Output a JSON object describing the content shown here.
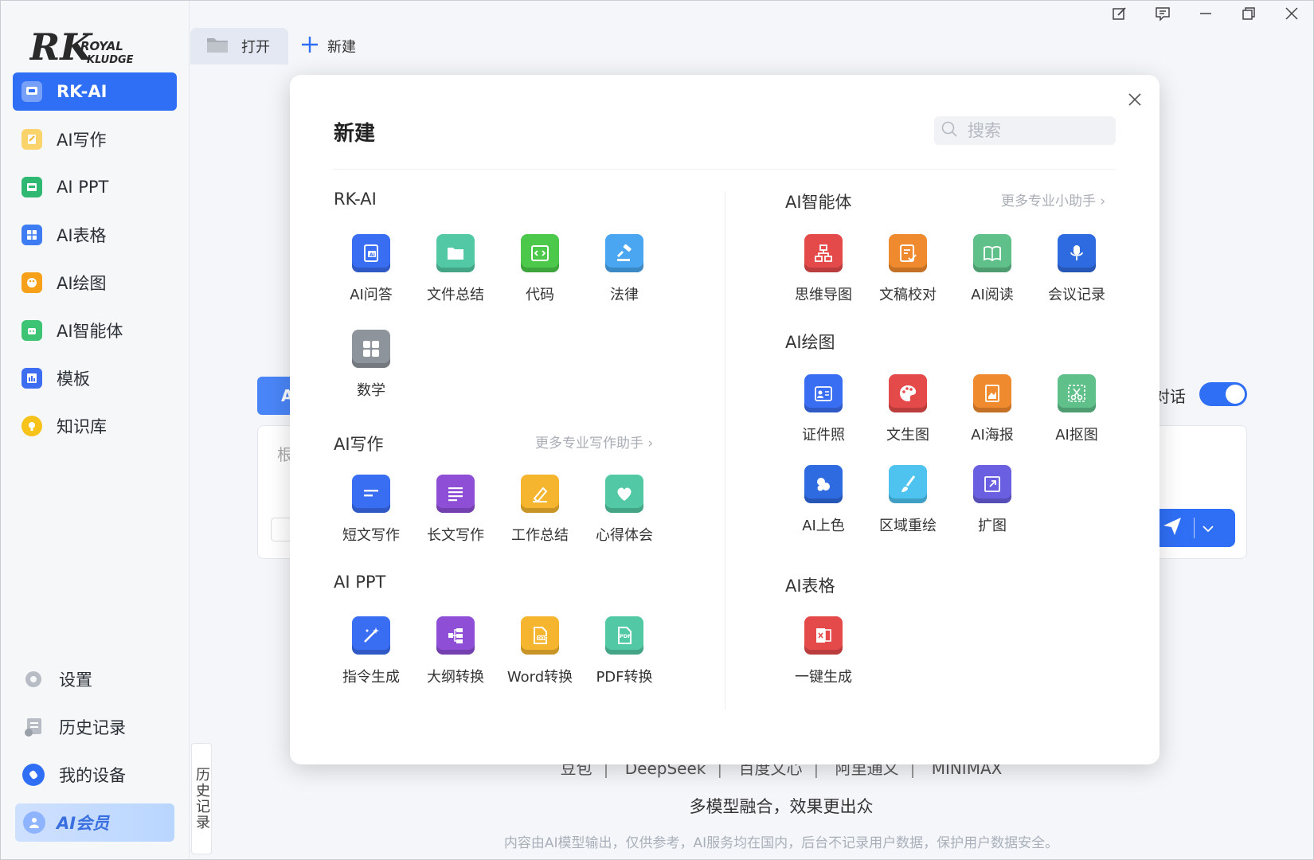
{
  "app": {
    "logo_main": "RK",
    "logo_line1": "ROYAL",
    "logo_line2": "KLUDGE"
  },
  "sidebar": {
    "items": [
      {
        "label": "RK-AI",
        "icon": "chat-icon",
        "color": "#ffffff",
        "active": true
      },
      {
        "label": "AI写作",
        "icon": "pen-icon",
        "color": "#f7b733"
      },
      {
        "label": "AI PPT",
        "icon": "ppt-icon",
        "color": "#2eb872"
      },
      {
        "label": "AI表格",
        "icon": "table-icon",
        "color": "#3d7cf2"
      },
      {
        "label": "AI绘图",
        "icon": "palette-icon",
        "color": "#f7a11a"
      },
      {
        "label": "AI智能体",
        "icon": "robot-icon",
        "color": "#3cc374"
      },
      {
        "label": "模板",
        "icon": "template-icon",
        "color": "#3d6ef2"
      },
      {
        "label": "知识库",
        "icon": "bulb-icon",
        "color": "#f7c21a"
      }
    ],
    "bottom": [
      {
        "label": "设置",
        "icon": "gear-icon"
      },
      {
        "label": "历史记录",
        "icon": "history-icon"
      },
      {
        "label": "我的设备",
        "icon": "device-icon"
      }
    ],
    "vip_label": "AI会员",
    "history_tab": "历史记录"
  },
  "topbar": {
    "open_label": "打开",
    "new_label": "新建"
  },
  "main": {
    "ai_chip": "A",
    "input_placeholder_fragment": "根",
    "toggle_label_fragment": "对话",
    "models": [
      "豆包",
      "DeepSeek",
      "百度文心",
      "阿里通义",
      "MINIMAX"
    ],
    "slogan": "多模型融合，效果更出众",
    "disclaimer": "内容由AI模型输出，仅供参考，AI服务均在国内，后台不记录用户数据，保护用户数据安全。"
  },
  "modal": {
    "title": "新建",
    "search_placeholder": "搜索",
    "sections": {
      "rkai": {
        "title": "RK-AI",
        "tools": [
          {
            "label": "AI问答",
            "icon": "ai-qa-icon",
            "color": "#3a6ef2"
          },
          {
            "label": "文件总结",
            "icon": "folder-icon",
            "color": "#52c9a4"
          },
          {
            "label": "代码",
            "icon": "code-icon",
            "color": "#4cc94a"
          },
          {
            "label": "法律",
            "icon": "gavel-icon",
            "color": "#4aa6f0"
          },
          {
            "label": "数学",
            "icon": "calculator-icon",
            "color": "#8e949c"
          }
        ]
      },
      "writing": {
        "title": "AI写作",
        "more": "更多专业写作助手",
        "tools": [
          {
            "label": "短文写作",
            "icon": "short-text-icon",
            "color": "#3a6ef2"
          },
          {
            "label": "长文写作",
            "icon": "long-text-icon",
            "color": "#8e4fd6"
          },
          {
            "label": "工作总结",
            "icon": "edit-icon",
            "color": "#f5b52e"
          },
          {
            "label": "心得体会",
            "icon": "heart-icon",
            "color": "#52c9a4"
          }
        ]
      },
      "ppt": {
        "title": "AI PPT",
        "tools": [
          {
            "label": "指令生成",
            "icon": "magic-wand-icon",
            "color": "#3a6ef2"
          },
          {
            "label": "大纲转换",
            "icon": "outline-icon",
            "color": "#8e4fd6"
          },
          {
            "label": "Word转换",
            "icon": "doc-icon",
            "color": "#f5b52e"
          },
          {
            "label": "PDF转换",
            "icon": "pdf-icon",
            "color": "#52c9a4"
          }
        ]
      },
      "agents": {
        "title": "AI智能体",
        "more": "更多专业小助手",
        "tools": [
          {
            "label": "思维导图",
            "icon": "mindmap-icon",
            "color": "#e54a4a"
          },
          {
            "label": "文稿校对",
            "icon": "proofread-icon",
            "color": "#f08a2e"
          },
          {
            "label": "AI阅读",
            "icon": "book-icon",
            "color": "#5fc08a"
          },
          {
            "label": "会议记录",
            "icon": "mic-icon",
            "color": "#2f6be0"
          }
        ]
      },
      "drawing": {
        "title": "AI绘图",
        "tools": [
          {
            "label": "证件照",
            "icon": "id-photo-icon",
            "color": "#3a6ef2"
          },
          {
            "label": "文生图",
            "icon": "palette-icon",
            "color": "#e54a4a"
          },
          {
            "label": "AI海报",
            "icon": "poster-icon",
            "color": "#f08a2e"
          },
          {
            "label": "AI抠图",
            "icon": "scissors-icon",
            "color": "#5fc08a"
          },
          {
            "label": "AI上色",
            "icon": "color-drop-icon",
            "color": "#2f6be0"
          },
          {
            "label": "区域重绘",
            "icon": "brush-icon",
            "color": "#4fc3f0"
          },
          {
            "label": "扩图",
            "icon": "expand-icon",
            "color": "#6a5fe0"
          }
        ]
      },
      "sheet": {
        "title": "AI表格",
        "tools": [
          {
            "label": "一键生成",
            "icon": "sheet-gen-icon",
            "color": "#e54a4a"
          }
        ]
      }
    }
  }
}
